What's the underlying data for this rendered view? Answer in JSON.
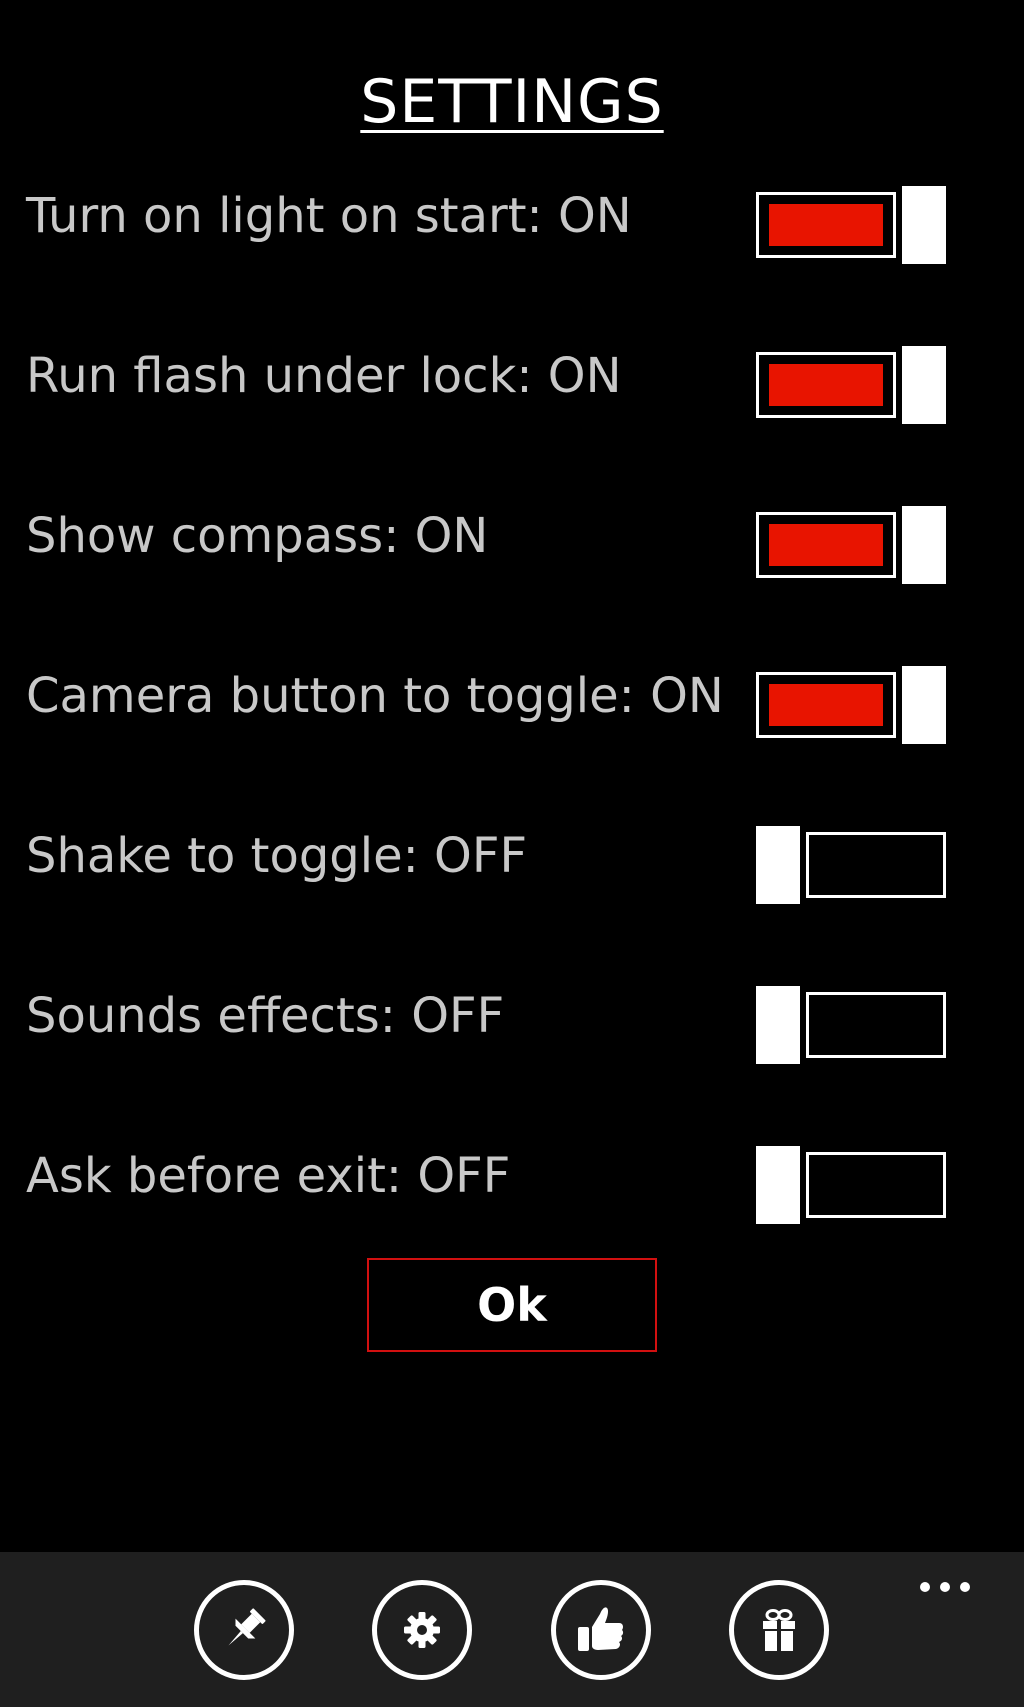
{
  "title": "SETTINGS",
  "settings": [
    {
      "label": "Turn on light on start: ON",
      "state": "on"
    },
    {
      "label": "Run flash under lock: ON",
      "state": "on"
    },
    {
      "label": "Show compass: ON",
      "state": "on"
    },
    {
      "label": "Camera button to toggle: ON",
      "state": "on"
    },
    {
      "label": "Shake to toggle: OFF",
      "state": "off"
    },
    {
      "label": "Sounds effects: OFF",
      "state": "off"
    },
    {
      "label": "Ask before exit: OFF",
      "state": "off"
    }
  ],
  "ok_label": "Ok",
  "app_bar": {
    "buttons": [
      {
        "icon": "pin-icon"
      },
      {
        "icon": "gear-icon"
      },
      {
        "icon": "thumbs-up-icon"
      },
      {
        "icon": "gift-icon"
      }
    ],
    "more_icon": "more-icon"
  },
  "colors": {
    "background": "#000000",
    "label": "#c8c8c8",
    "accent": "#e81400",
    "app_bar": "#1f1f1f",
    "ok_border": "#d21010"
  }
}
